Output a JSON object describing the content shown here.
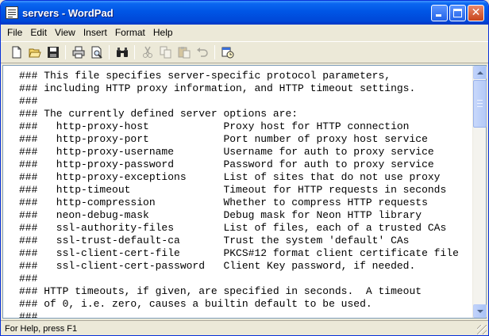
{
  "window": {
    "title": "servers - WordPad"
  },
  "menu": [
    "File",
    "Edit",
    "View",
    "Insert",
    "Format",
    "Help"
  ],
  "toolbar": {
    "buttons": [
      {
        "icon": "new-document-icon",
        "enabled": true
      },
      {
        "icon": "open-folder-icon",
        "enabled": true
      },
      {
        "icon": "save-icon",
        "enabled": true
      },
      {
        "icon": "print-icon",
        "enabled": true
      },
      {
        "icon": "print-preview-icon",
        "enabled": true
      },
      {
        "icon": "find-icon",
        "enabled": true
      },
      {
        "icon": "cut-icon",
        "enabled": false
      },
      {
        "icon": "copy-icon",
        "enabled": false
      },
      {
        "icon": "paste-icon",
        "enabled": false
      },
      {
        "icon": "undo-icon",
        "enabled": false
      },
      {
        "icon": "insert-date-time-icon",
        "enabled": true
      }
    ]
  },
  "document": {
    "lines": [
      "### This file specifies server-specific protocol parameters,",
      "### including HTTP proxy information, and HTTP timeout settings.",
      "###",
      "### The currently defined server options are:",
      "###   http-proxy-host            Proxy host for HTTP connection",
      "###   http-proxy-port            Port number of proxy host service",
      "###   http-proxy-username        Username for auth to proxy service",
      "###   http-proxy-password        Password for auth to proxy service",
      "###   http-proxy-exceptions      List of sites that do not use proxy",
      "###   http-timeout               Timeout for HTTP requests in seconds",
      "###   http-compression           Whether to compress HTTP requests",
      "###   neon-debug-mask            Debug mask for Neon HTTP library",
      "###   ssl-authority-files        List of files, each of a trusted CAs",
      "###   ssl-trust-default-ca       Trust the system 'default' CAs",
      "###   ssl-client-cert-file       PKCS#12 format client certificate file",
      "###   ssl-client-cert-password   Client Key password, if needed.",
      "###",
      "### HTTP timeouts, if given, are specified in seconds.  A timeout",
      "### of 0, i.e. zero, causes a builtin default to be used.",
      "###"
    ]
  },
  "statusbar": {
    "text": "For Help, press F1"
  },
  "colors": {
    "titlebar": "#0055E5",
    "chrome": "#ECE9D8",
    "document": "#FFFFFF"
  }
}
